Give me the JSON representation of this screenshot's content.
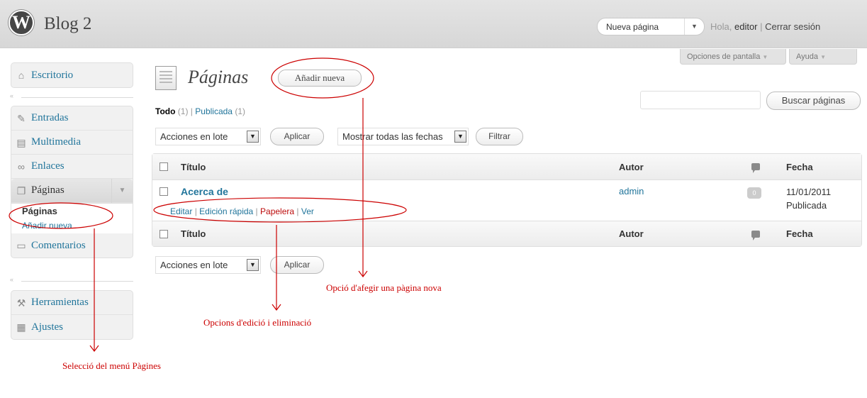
{
  "header": {
    "logo_glyph": "W",
    "site_title": "Blog 2",
    "favorite_action": "Nueva página",
    "favorite_toggle": "▼",
    "greeting": "Hola,",
    "user_name": "editor",
    "separator": "|",
    "logout": "Cerrar sesión",
    "screen_options": "Opciones de pantalla",
    "help": "Ayuda",
    "dropdown_glyph": "▼"
  },
  "sidebar": {
    "dashboard": "Escritorio",
    "posts": "Entradas",
    "media": "Multimedia",
    "links": "Enlaces",
    "pages": "Páginas",
    "pages_submenu": [
      "Páginas",
      "Añadir nueva"
    ],
    "comments": "Comentarios",
    "tools": "Herramientas",
    "settings": "Ajustes",
    "collapse_glyph": "«"
  },
  "main": {
    "page_title": "Páginas",
    "add_new": "Añadir nueva",
    "filter_all": "Todo",
    "filter_all_count": "(1)",
    "filter_published": "Publicada",
    "filter_published_count": "(1)",
    "filter_sep": "|",
    "search_button": "Buscar páginas",
    "search_value": "",
    "bulk_actions": "Acciones en lote",
    "apply": "Aplicar",
    "date_filter": "Mostrar todas las fechas",
    "filter_button": "Filtrar"
  },
  "table": {
    "col_title": "Título",
    "col_author": "Autor",
    "col_date": "Fecha",
    "rows": [
      {
        "title": "Acerca de",
        "actions": [
          "Editar",
          "Edición rápida",
          "Papelera",
          "Ver"
        ],
        "author": "admin",
        "comments": "0",
        "date": "11/01/2011",
        "status": "Publicada"
      }
    ]
  },
  "annotations": {
    "add_page": "Opció d'afegir una pàgina nova",
    "edit_options": "Opcions d'edició i eliminació",
    "menu_selection": "Selecció del menú Pàgines",
    "accent_color": "#cc0000"
  }
}
